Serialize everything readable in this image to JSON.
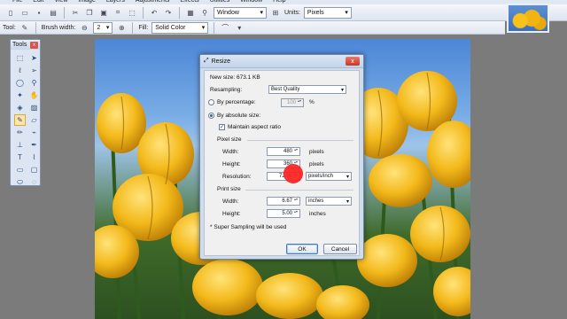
{
  "menubar": {
    "items": [
      "File",
      "Edit",
      "View",
      "Image",
      "Layers",
      "Adjustments",
      "Effects",
      "Utilities",
      "Window",
      "Help"
    ]
  },
  "toolbar1": {
    "window_select": "Window",
    "units_label": "Units:",
    "units_value": "Pixels"
  },
  "toolbar2": {
    "tool_label": "Tool:",
    "brush_width_label": "Brush width:",
    "brush_width_value": "2",
    "fill_label": "Fill:",
    "fill_value": "Solid Color"
  },
  "tools_window": {
    "title": "Tools",
    "close": "x"
  },
  "dialog": {
    "title": "Resize",
    "close": "x",
    "new_size": "New size: 673.1 KB",
    "resampling_label": "Resampling:",
    "resampling_value": "Best Quality",
    "by_percentage_label": "By percentage:",
    "percentage_value": "100",
    "percent_unit": "%",
    "by_absolute_label": "By absolute size:",
    "maintain_aspect_label": "Maintain aspect ratio",
    "pixel_size_label": "Pixel size",
    "width_label": "Width:",
    "width_value": "480",
    "width_unit": "pixels",
    "height_label": "Height:",
    "height_value": "360",
    "height_unit": "pixels",
    "resolution_label": "Resolution:",
    "resolution_value": "72.00",
    "resolution_unit": "pixels/inch",
    "print_size_label": "Print size",
    "print_width_label": "Width:",
    "print_width_value": "6.67",
    "print_width_unit": "inches",
    "print_height_label": "Height:",
    "print_height_value": "5.00",
    "print_height_unit": "inches",
    "note": "* Super Sampling will be used",
    "ok_label": "OK",
    "cancel_label": "Cancel"
  },
  "colors": {
    "accent": "#3d7bd0",
    "cursor": "#ff2020",
    "tulip": "#f3b91a"
  }
}
